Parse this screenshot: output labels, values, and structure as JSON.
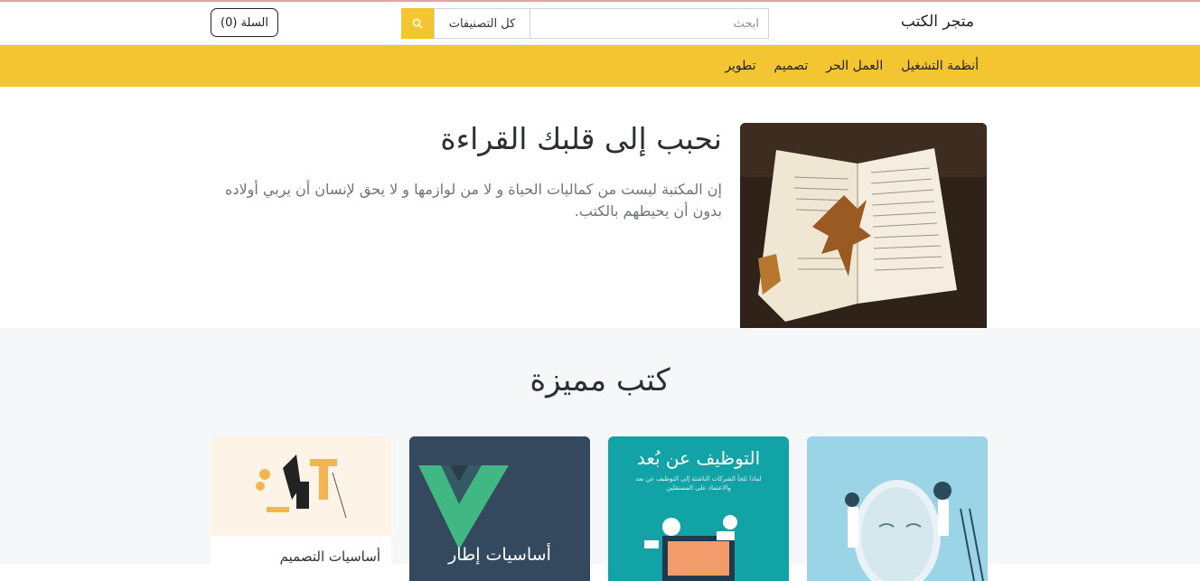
{
  "header": {
    "brand": "متجر الكتب",
    "search_placeholder": "ابحث",
    "category_select": "كل التصنيفات",
    "cart_label": "السلة (0)"
  },
  "nav": {
    "items": [
      {
        "label": "تطوير"
      },
      {
        "label": "تصميم"
      },
      {
        "label": "العمل الحر"
      },
      {
        "label": "أنظمة التشغيل"
      }
    ]
  },
  "hero": {
    "title": "نحبب إلى قلبك القراءة",
    "text": "إن المكتبة ليست من كماليات الحياة و لا من لوازمها و لا يحق لإنسان أن يربي أولاده بدون أن يحيطهم بالكتب."
  },
  "featured": {
    "title": "كتب مميزة",
    "books": [
      {
        "cover_title": "",
        "label": ""
      },
      {
        "cover_title": "التوظيف عن بُعد",
        "cover_sub": "لماذا تلجأ الشركات الناشئة إلى التوظيف عن بعد والاعتماد على المستقلين",
        "label": ""
      },
      {
        "cover_title": "أساسيات إطار",
        "label": ""
      },
      {
        "cover_title": "",
        "label": "أساسيات التصميم"
      }
    ]
  },
  "colors": {
    "accent": "#f2c531",
    "vue_blue": "#34495e",
    "vue_green": "#41b883",
    "teal": "#11a3a6",
    "sky": "#9ad4e6"
  }
}
